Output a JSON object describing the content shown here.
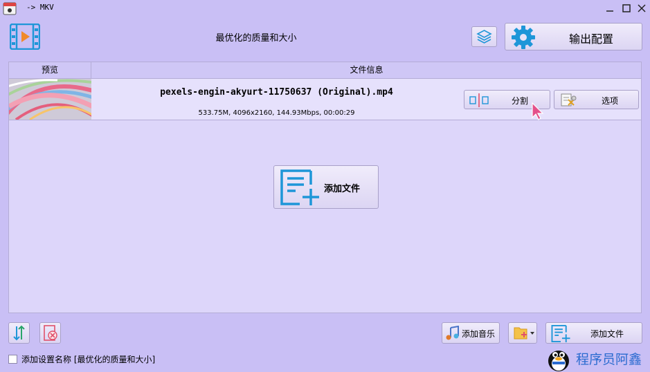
{
  "window": {
    "title": "-> MKV",
    "controls": [
      "minimize-icon",
      "maximize-icon",
      "close-icon"
    ]
  },
  "header": {
    "preset_title": "最优化的质量和大小",
    "output_config_label": "输出配置"
  },
  "table": {
    "columns": [
      "预览",
      "文件信息"
    ],
    "rows": [
      {
        "filename": "pexels-engin-akyurt-11750637 (Original).mp4",
        "meta": "533.75M, 4096x2160, 144.93Mbps, 00:00:29",
        "split_label": "分割",
        "options_label": "选项"
      }
    ]
  },
  "center": {
    "add_file_label": "添加文件"
  },
  "bottom": {
    "add_music_label": "添加音乐",
    "add_file_label": "添加文件",
    "checkbox_label": "添加设置名称 [最优化的质量和大小]",
    "checkbox_checked": false
  },
  "watermark": {
    "text": "程序员阿鑫"
  },
  "colors": {
    "background": "#c9bff5",
    "panel": "#ddd6fa",
    "accent_blue": "#1e96d8",
    "accent_red": "#e0506a"
  }
}
